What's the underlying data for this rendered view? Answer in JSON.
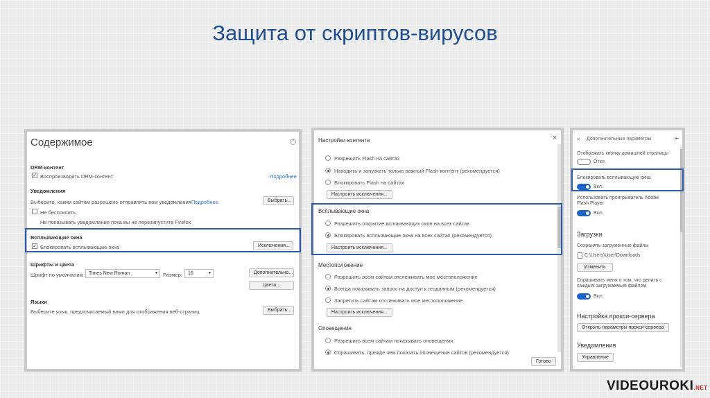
{
  "slide": {
    "title": "Защита от скриптов-вирусов",
    "logo_a": "VIDEOUROKI",
    "logo_b": ".NET"
  },
  "left": {
    "title": "Содержимое",
    "help_icon": "?",
    "drm_header": "DRM-контент",
    "drm_label": "Воспроизводить DRM-контент",
    "drm_link": "Подробнее",
    "notif_header": "Уведомления",
    "notif_text": "Выберите, каким сайтам разрешено отправлять вам уведомления",
    "notif_link": "Подробнее",
    "notif_btn": "Выбрать...",
    "dnd_label": "Не беспокоить",
    "dnd_sub": "Не показывать уведомления пока вы не перезапустите Firefox",
    "popup_header": "Всплывающие окна",
    "popup_label": "Блокировать всплывающие окна",
    "popup_btn": "Исключения...",
    "fonts_header": "Шрифты и цвета",
    "font_label": "Шрифт по умолчанию:",
    "font_value": "Times New Roman",
    "size_label": "Размер:",
    "size_value": "16",
    "advanced_btn": "Дополнительно...",
    "colors_btn": "Цвета...",
    "lang_header": "Языки",
    "lang_text": "Выберите язык, предпочитаемый вами для отображения веб-страниц",
    "lang_btn": "Выбрать..."
  },
  "middle": {
    "close_icon": "×",
    "content_header": "Настройки контента",
    "flash_allow": "Разрешить Flash на сайтах",
    "flash_important": "Находить и запускать только важный Flash-контент (рекомендуется)",
    "flash_block": "Блокировать Flash на сайтах",
    "flash_exc_btn": "Настроить исключения...",
    "popup_header": "Всплывающие окна",
    "popup_allow": "Разрешить открытие всплывающих окон на всех сайтах",
    "popup_block": "Блокировать всплывающие окна на всех сайтах (рекомендуется)",
    "popup_exc_btn": "Настроить исключения...",
    "loc_header": "Местоположение",
    "loc_allow": "Разрешить всем сайтам отслеживать мое местоположение",
    "loc_ask": "Всегда показывать запрос на доступ к геоданным (рекомендуется)",
    "loc_deny": "Запретить сайтам отслеживать мое местоположение",
    "loc_exc_btn": "Настроить исключения...",
    "alerts_header": "Оповещения",
    "alerts_allow": "Разрешить всем сайтам показывать оповещения",
    "alerts_ask": "Спрашивать, прежде чем показать оповещение сайтов (рекомендуется)",
    "done_btn": "Готово"
  },
  "right": {
    "back_icon": "«",
    "title": "Дополнительные параметры",
    "pin_icon": "⇤",
    "home_label": "Отображать кнопку домашней страницы",
    "home_state": "Откл.",
    "popup_label": "Блокировать всплывающие окна",
    "popup_state": "Вкл.",
    "flash_label": "Использовать проигрыватель Adobe Flash Player",
    "flash_state": "Вкл.",
    "downloads_header": "Загрузки",
    "save_label": "Сохранять загруженные файлы",
    "path_value": "C:\\Users\\User\\Downloads",
    "change_btn": "Изменить",
    "ask_label": "Спрашивать меня о том, что делать с каждым загружаемым файлом",
    "ask_state": "Вкл.",
    "proxy_header": "Настройка прокси-сервера",
    "proxy_btn": "Открыть параметры прокси-сервера",
    "notif_header": "Уведомления",
    "manage_btn": "Управление"
  },
  "colors": {
    "title": "#1f4e8c",
    "highlight": "#2b5cab",
    "toggle": "#1a63c9",
    "link": "#2a77d2"
  }
}
